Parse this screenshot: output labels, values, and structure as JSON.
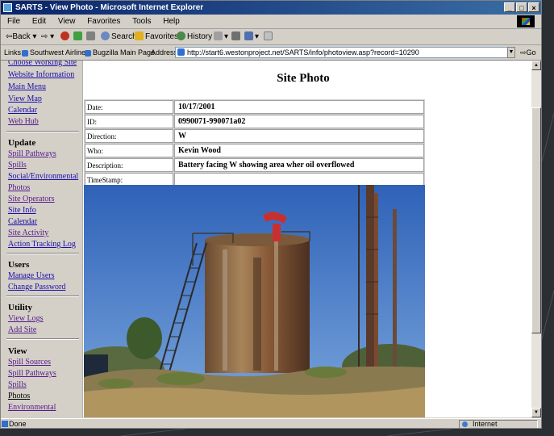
{
  "window": {
    "title": "SARTS - View Photo - Microsoft Internet Explorer",
    "minimize": "_",
    "maximize": "□",
    "close": "×"
  },
  "menu": [
    "File",
    "Edit",
    "View",
    "Favorites",
    "Tools",
    "Help"
  ],
  "toolbar": {
    "back": "Back",
    "search": "Search",
    "favorites": "Favorites",
    "history": "History"
  },
  "links_bar": {
    "label": "Links",
    "items": [
      "Southwest Airlines",
      "Bugzilla Main Page"
    ],
    "address_label": "Address",
    "url": "http://start6.westonproject.net/SARTS/info/photoview.asp?record=10290",
    "go": "Go"
  },
  "sidebar": {
    "top_links": [
      "Choose Working Site",
      "Website Information",
      "Main Menu",
      "View Map",
      "Calendar",
      "Web Hub"
    ],
    "sections": [
      {
        "title": "Update",
        "links": [
          "Spill Pathways",
          "Spills",
          "Social/Environmental",
          "Photos",
          "Site Operators",
          "Site Info",
          "Calendar",
          "Site Activity",
          "Action Tracking Log"
        ]
      },
      {
        "title": "Users",
        "links": [
          "Manage Users",
          "Change Password"
        ]
      },
      {
        "title": "Utility",
        "links": [
          "View Logs",
          "Add Site"
        ]
      },
      {
        "title": "View",
        "links": [
          "Spill Sources",
          "Spill Pathways",
          "Spills",
          "Photos",
          "Environmental"
        ]
      }
    ]
  },
  "page": {
    "title": "Site Photo",
    "rows": [
      {
        "label": "Date:",
        "value": "10/17/2001"
      },
      {
        "label": "ID:",
        "value": "0990071-990071a02"
      },
      {
        "label": "Direction:",
        "value": "W"
      },
      {
        "label": "Who:",
        "value": "Kevin Wood"
      },
      {
        "label": "Description:",
        "value": "Battery facing W showing area wher oil overflowed"
      },
      {
        "label": "TimeStamp:",
        "value": ""
      }
    ]
  },
  "status": {
    "text": "Done",
    "zone": "Internet"
  }
}
